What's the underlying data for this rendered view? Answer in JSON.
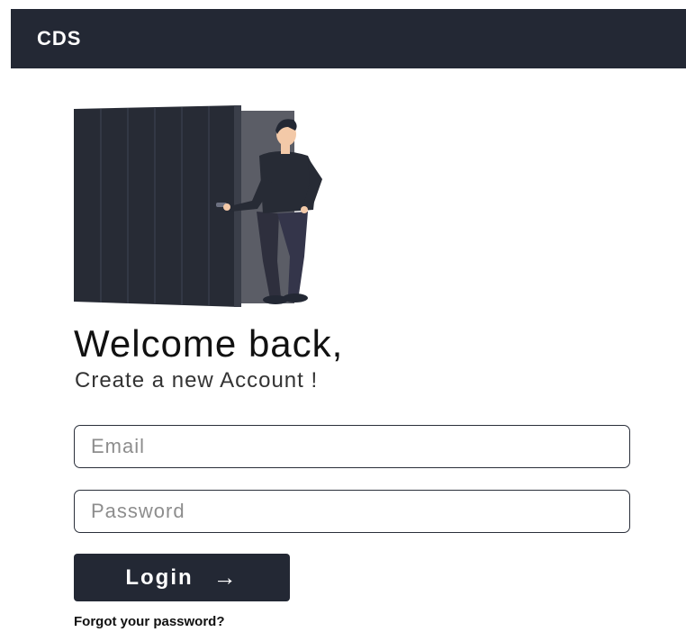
{
  "header": {
    "title": "CDS"
  },
  "hero": {
    "illustration_icon": "person-opening-door-illustration"
  },
  "main": {
    "heading": "Welcome back,",
    "subheading": "Create a new Account !"
  },
  "form": {
    "email": {
      "placeholder": "Email",
      "value": ""
    },
    "password": {
      "placeholder": "Password",
      "value": ""
    },
    "login_label": "Login",
    "login_arrow_icon": "arrow-right-icon",
    "forgot_label": "Forgot your password?"
  },
  "colors": {
    "brand_dark": "#232834",
    "background": "#ffffff",
    "placeholder": "#8d8d8d"
  }
}
